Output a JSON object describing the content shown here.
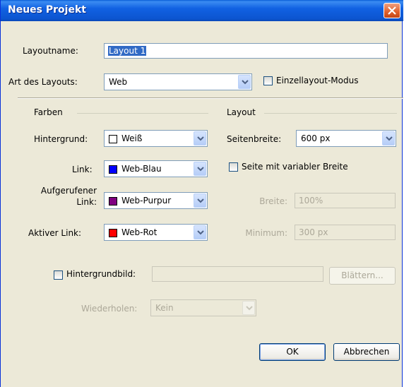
{
  "window": {
    "title": "Neues Projekt"
  },
  "layoutname": {
    "label": "Layoutname:",
    "value": "Layout 1"
  },
  "layout_type": {
    "label": "Art des Layouts:",
    "value": "Web"
  },
  "single_layout_mode": {
    "label": "Einzellayout-Modus",
    "checked": false
  },
  "colors": {
    "group_label": "Farben",
    "background": {
      "label": "Hintergrund:",
      "value": "Weiß",
      "color": "#ffffff"
    },
    "link": {
      "label": "Link:",
      "value": "Web-Blau",
      "color": "#0000ff"
    },
    "visited_link": {
      "label_line1": "Aufgerufener",
      "label_line2": "Link:",
      "value": "Web-Purpur",
      "color": "#800080"
    },
    "active_link": {
      "label": "Aktiver Link:",
      "value": "Web-Rot",
      "color": "#ff0000"
    }
  },
  "layout": {
    "group_label": "Layout",
    "page_width": {
      "label": "Seitenbreite:",
      "value": "600 px"
    },
    "variable_width": {
      "label": "Seite mit variabler Breite",
      "checked": false
    },
    "width": {
      "label": "Breite:",
      "value": "100%"
    },
    "minimum": {
      "label": "Minimum:",
      "value": "300 px"
    }
  },
  "background_image": {
    "label": "Hintergrundbild:",
    "value": "",
    "browse_label": "Blättern...",
    "checked": false
  },
  "repeat": {
    "label": "Wiederholen:",
    "value": "Kein"
  },
  "buttons": {
    "ok": "OK",
    "cancel": "Abbrechen"
  }
}
